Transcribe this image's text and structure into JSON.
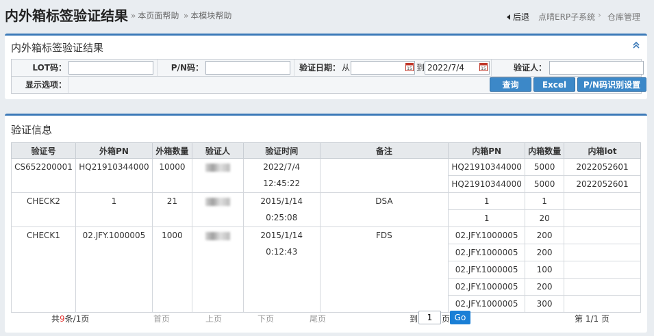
{
  "header": {
    "title": "内外箱标签验证结果",
    "help_page": "本页面帮助",
    "help_module": "本模块帮助",
    "back": "后退",
    "crumbs": [
      "点晴ERP子系统",
      "仓库管理"
    ]
  },
  "filter": {
    "panel_title": "内外箱标签验证结果",
    "lot_label": "LOT码：",
    "lot_value": "",
    "pn_label": "P/N码：",
    "pn_value": "",
    "date_label": "验证日期：",
    "from": "从",
    "from_value": "",
    "to": "到",
    "to_value": "2022/7/4",
    "verifier_label": "验证人：",
    "verifier_value": "",
    "display_label": "显示选项：",
    "query_btn": "查询",
    "excel_btn": "Excel",
    "pn_setting_btn": "P/N码识别设置"
  },
  "results": {
    "panel_title": "验证信息",
    "columns": [
      "验证号",
      "外箱PN",
      "外箱数量",
      "验证人",
      "验证时间",
      "备注",
      "内箱PN",
      "内箱数量",
      "内箱lot"
    ],
    "groups": [
      {
        "id": "CS652200001",
        "outer_pn": "HQ21910344000",
        "outer_qty": "10000",
        "time": "2022/7/4 12:45:22",
        "note": "",
        "inner": [
          [
            "HQ21910344000",
            "5000",
            "2022052601"
          ],
          [
            "HQ21910344000",
            "5000",
            "2022052601"
          ]
        ]
      },
      {
        "id": "CHECK2",
        "outer_pn": "1",
        "outer_qty": "21",
        "time": "2015/1/14 0:25:08",
        "note": "DSA",
        "inner": [
          [
            "1",
            "1",
            ""
          ],
          [
            "1",
            "20",
            ""
          ]
        ]
      },
      {
        "id": "CHECK1",
        "outer_pn": "02.JFY.1000005",
        "outer_qty": "1000",
        "time": "2015/1/14 0:12:43",
        "note": "FDS",
        "inner": [
          [
            "02.JFY.1000005",
            "200",
            ""
          ],
          [
            "02.JFY.1000005",
            "200",
            ""
          ],
          [
            "02.JFY.1000005",
            "100",
            ""
          ],
          [
            "02.JFY.1000005",
            "200",
            ""
          ],
          [
            "02.JFY.1000005",
            "300",
            ""
          ]
        ]
      }
    ]
  },
  "pager": {
    "total_prefix": "共",
    "total_count": "9",
    "total_suffix": "条/1页",
    "first": "首页",
    "prev": "上页",
    "next": "下页",
    "last": "尾页",
    "goto_prefix": "到",
    "goto_value": "1",
    "goto_suffix": "页",
    "go": "Go",
    "page_info": "第 1/1 页"
  },
  "colors": {
    "accent": "#3b79b8",
    "button": "#3c88c8",
    "go": "#1a7fd6",
    "highlight": "#e53935"
  }
}
